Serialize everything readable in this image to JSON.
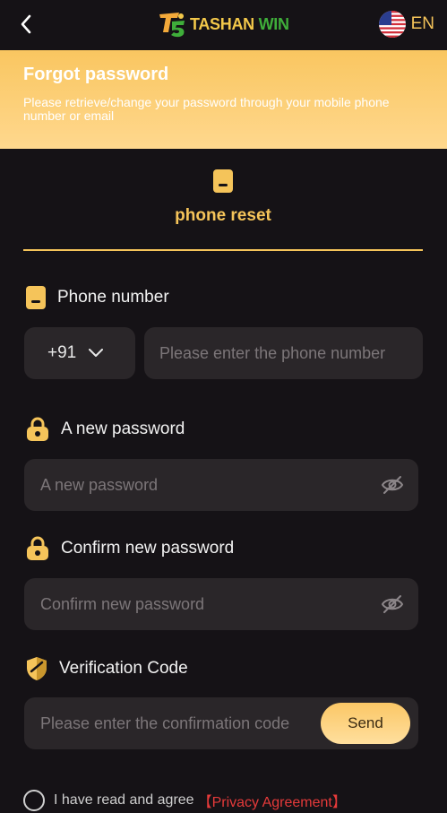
{
  "header": {
    "logo_word1": "TASHAN",
    "logo_word2": "WIN",
    "language": "EN"
  },
  "banner": {
    "title": "Forgot password",
    "subtitle": "Please retrieve/change your password through your mobile phone number or email"
  },
  "tab": {
    "label": "phone reset"
  },
  "phone": {
    "label": "Phone number",
    "country_code": "+91",
    "placeholder": "Please enter the phone number"
  },
  "new_password": {
    "label": "A new password",
    "placeholder": "A new password"
  },
  "confirm_password": {
    "label": "Confirm new password",
    "placeholder": "Confirm new password"
  },
  "verification": {
    "label": "Verification Code",
    "placeholder": "Please enter the confirmation code",
    "send_label": "Send"
  },
  "agreement": {
    "text": "I have read and agree",
    "link": "【Privacy Agreement】"
  },
  "colors": {
    "accent": "#f5c45a",
    "background": "#151216",
    "input_bg": "#2a2629",
    "link": "#e53a3a"
  }
}
